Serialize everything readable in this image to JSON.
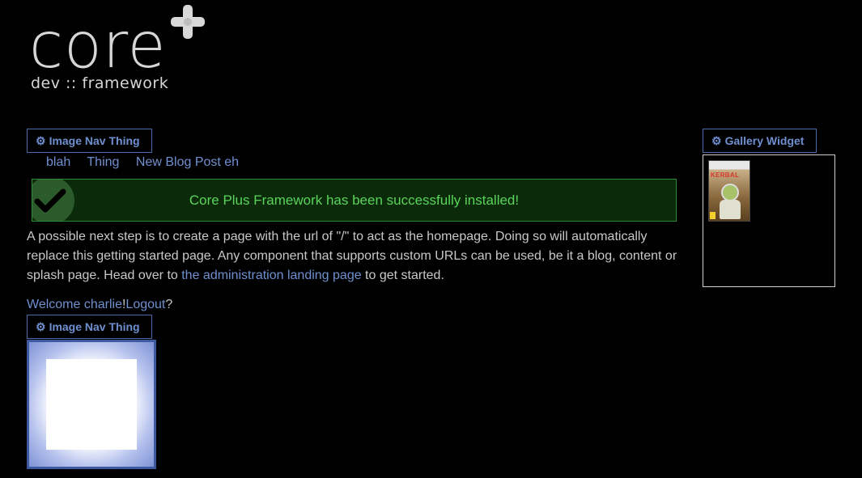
{
  "logo": {
    "word": "core",
    "sub": "dev :: framework"
  },
  "widgets": {
    "image_nav_top": {
      "title": "Image Nav Thing"
    },
    "image_nav_bottom": {
      "title": "Image Nav Thing"
    },
    "gallery": {
      "title": "Gallery Widget",
      "thumbnail_title": "KERBAL"
    }
  },
  "nav": {
    "links": [
      "blah",
      "Thing",
      "New Blog Post eh"
    ]
  },
  "success_message": "Core Plus Framework has been successfully installed!",
  "intro": {
    "text_before": "A possible next step is to create a page with the url of \"/\" to act as the homepage. Doing so will automatically replace this getting started page. Any component that supports custom URLs can be used, be it a blog, content or splash page. Head over to ",
    "link": "the administration landing page",
    "text_after": " to get started."
  },
  "welcome": {
    "greeting": "Welcome charlie",
    "sep": "!",
    "logout": "Logout",
    "end": "?"
  },
  "colors": {
    "link": "#6f8fd0",
    "success_text": "#5ad45a",
    "success_border": "#2e8a2e",
    "background": "#000000"
  }
}
